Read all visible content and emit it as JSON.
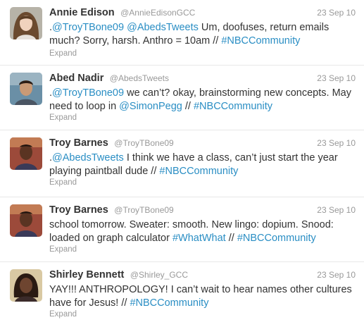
{
  "tweets": [
    {
      "avatar_icon": "avatar-annie",
      "name": "Annie Edison",
      "handle": "@AnnieEdisonGCC",
      "date": "23 Sep 10",
      "t0": ".",
      "l1": "@TroyTBone09",
      "t1": " ",
      "l2": "@AbedsTweets",
      "t2": " Um, doofuses, return emails much? Sorry, harsh. Anthro = 10am // ",
      "l3": "#NBCCommunity",
      "expand": "Expand"
    },
    {
      "avatar_icon": "avatar-abed",
      "name": "Abed Nadir",
      "handle": "@AbedsTweets",
      "date": "23 Sep 10",
      "t0": ".",
      "l1": "@TroyTBone09",
      "t1": " we can’t? okay, brainstorming new concepts. May need to loop in ",
      "l2": "@SimonPegg",
      "t2": " // ",
      "l3": "#NBCCommunity",
      "expand": "Expand"
    },
    {
      "avatar_icon": "avatar-troy",
      "name": "Troy Barnes",
      "handle": "@TroyTBone09",
      "date": "23 Sep 10",
      "t0": ".",
      "l1": "@AbedsTweets",
      "t1": " I think we have a class, can’t just start the year playing paintball dude // ",
      "l2": "#NBCCommunity",
      "expand": "Expand"
    },
    {
      "avatar_icon": "avatar-troy",
      "name": "Troy Barnes",
      "handle": "@TroyTBone09",
      "date": "23 Sep 10",
      "t0": "school tomorrow. Sweater: smooth. New lingo: dopium. Snood: loaded on graph calculator ",
      "l1": "#WhatWhat",
      "t1": " // ",
      "l2": "#NBCCommunity",
      "expand": "Expand"
    },
    {
      "avatar_icon": "avatar-shirley",
      "name": "Shirley Bennett",
      "handle": "@Shirley_GCC",
      "date": "23 Sep 10",
      "t0": "YAY!!! ANTHROPOLOGY! I can’t wait to hear names other cultures have for Jesus! // ",
      "l1": "#NBCCommunity",
      "expand": "Expand"
    }
  ],
  "colors": {
    "link": "#2a8ec4",
    "name": "#333333",
    "meta": "#999999",
    "divider": "#e8e8e8"
  }
}
